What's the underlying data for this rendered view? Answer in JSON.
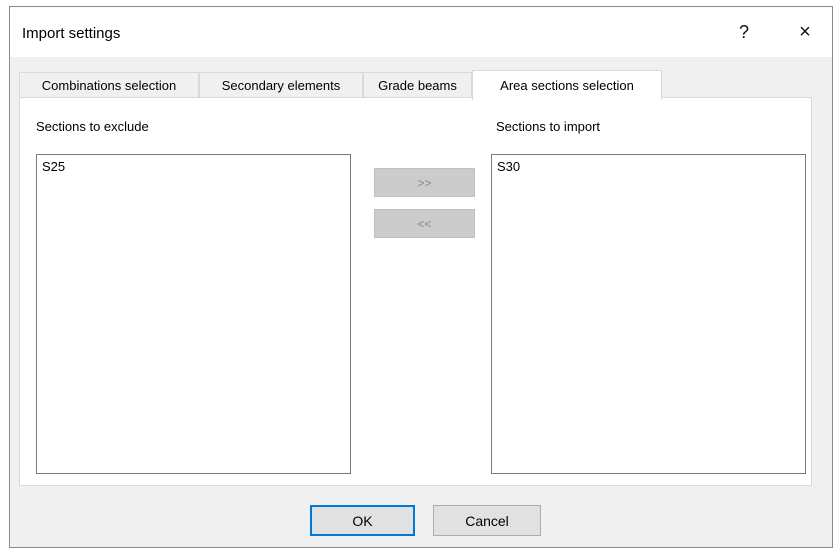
{
  "window": {
    "title": "Import settings",
    "help_label": "?",
    "close_label": "×"
  },
  "tabs": [
    {
      "label": "Combinations selection",
      "active": false
    },
    {
      "label": "Secondary elements",
      "active": false
    },
    {
      "label": "Grade beams",
      "active": false
    },
    {
      "label": "Area sections selection",
      "active": true
    }
  ],
  "exclude": {
    "label": "Sections to exclude",
    "items": [
      "S25"
    ]
  },
  "import": {
    "label": "Sections to import",
    "items": [
      "S30"
    ]
  },
  "transfer": {
    "add_label": ">>",
    "remove_label": "<<"
  },
  "footer": {
    "ok_label": "OK",
    "cancel_label": "Cancel"
  }
}
